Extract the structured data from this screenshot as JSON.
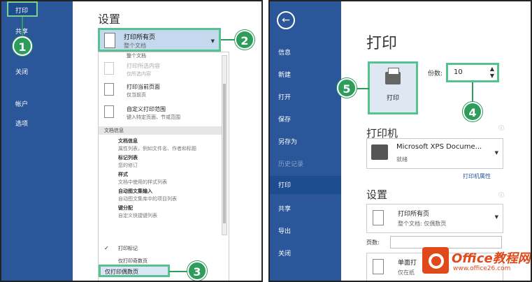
{
  "left": {
    "sidebar": {
      "active": "打印",
      "items": [
        "共享",
        "关闭",
        "帐户",
        "选项"
      ]
    },
    "settings_title": "设置",
    "print_scope": {
      "label": "打印所有页",
      "sub": "整个文档"
    },
    "dropdown": {
      "top_partial": "整个文档",
      "items": [
        {
          "label": "打印所选内容",
          "sub": "仅所选内容"
        },
        {
          "label": "打印当前页面",
          "sub": "仅当前页"
        },
        {
          "label": "自定义打印范围",
          "sub": "键入特定页面、节或范围"
        }
      ],
      "section": "文档信息",
      "info_options": [
        {
          "label": "文档信息",
          "sub": "属性列表，例如文件名、作者和标题"
        },
        {
          "label": "标记列表",
          "sub": "您的修订"
        },
        {
          "label": "样式",
          "sub": "文档中使用的样式列表"
        },
        {
          "label": "自动图文集输入",
          "sub": "自动图文集库中的项目列表"
        },
        {
          "label": "键分配",
          "sub": "自定义快捷键列表"
        }
      ],
      "print_markup": "打印标记",
      "odd_pages": "仅打印奇数页",
      "even_pages": "仅打印偶数页"
    },
    "badges": [
      "1",
      "2",
      "3"
    ]
  },
  "right": {
    "sidebar": {
      "back": "←",
      "items": [
        "信息",
        "新建",
        "打开",
        "保存",
        "另存为",
        "历史记录"
      ],
      "active": "打印",
      "items_after": [
        "共享",
        "导出",
        "关闭"
      ]
    },
    "title": "打印",
    "print_button": "打印",
    "copies_label": "份数:",
    "copies_value": "10",
    "printer_heading": "打印机",
    "printer": {
      "name": "Microsoft XPS Docume...",
      "status": "就绪"
    },
    "printer_properties": "打印机属性",
    "settings_heading": "设置",
    "pages_setting": {
      "label": "打印所有页",
      "sub": "整个文档: 仅偶数页"
    },
    "pages_label": "页数:",
    "single_side": {
      "label": "单面打",
      "sub": "仅在纸"
    },
    "badges": [
      "5",
      "4"
    ],
    "logo": {
      "word": "Office教程网",
      "url": "www.office26.com"
    }
  }
}
